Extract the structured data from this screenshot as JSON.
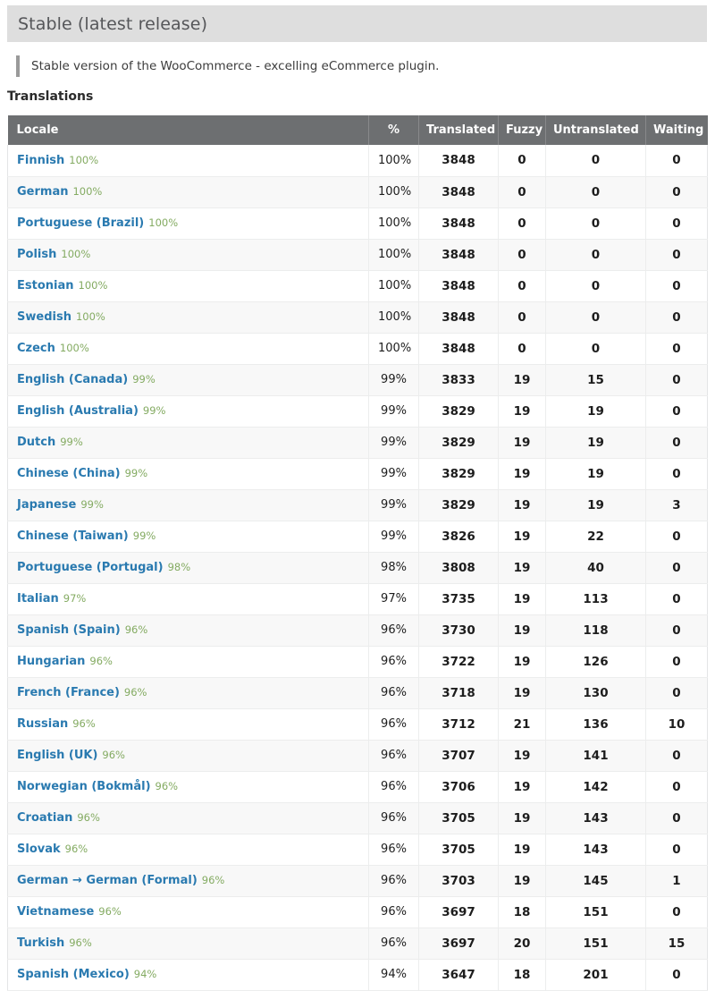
{
  "release": {
    "banner_title": "Stable (latest release)",
    "description": "Stable version of the WooCommerce - excelling eCommerce plugin."
  },
  "translations_section": {
    "heading": "Translations",
    "columns": {
      "locale": "Locale",
      "percent": "%",
      "translated": "Translated",
      "fuzzy": "Fuzzy",
      "untranslated": "Untranslated",
      "waiting": "Waiting"
    },
    "rows": [
      {
        "locale": "Finnish",
        "locale_pct": "100%",
        "percent": "100%",
        "translated": "3848",
        "fuzzy": "0",
        "untranslated": "0",
        "waiting": "0"
      },
      {
        "locale": "German",
        "locale_pct": "100%",
        "percent": "100%",
        "translated": "3848",
        "fuzzy": "0",
        "untranslated": "0",
        "waiting": "0"
      },
      {
        "locale": "Portuguese (Brazil)",
        "locale_pct": "100%",
        "percent": "100%",
        "translated": "3848",
        "fuzzy": "0",
        "untranslated": "0",
        "waiting": "0"
      },
      {
        "locale": "Polish",
        "locale_pct": "100%",
        "percent": "100%",
        "translated": "3848",
        "fuzzy": "0",
        "untranslated": "0",
        "waiting": "0"
      },
      {
        "locale": "Estonian",
        "locale_pct": "100%",
        "percent": "100%",
        "translated": "3848",
        "fuzzy": "0",
        "untranslated": "0",
        "waiting": "0"
      },
      {
        "locale": "Swedish",
        "locale_pct": "100%",
        "percent": "100%",
        "translated": "3848",
        "fuzzy": "0",
        "untranslated": "0",
        "waiting": "0"
      },
      {
        "locale": "Czech",
        "locale_pct": "100%",
        "percent": "100%",
        "translated": "3848",
        "fuzzy": "0",
        "untranslated": "0",
        "waiting": "0"
      },
      {
        "locale": "English (Canada)",
        "locale_pct": "99%",
        "percent": "99%",
        "translated": "3833",
        "fuzzy": "19",
        "untranslated": "15",
        "waiting": "0"
      },
      {
        "locale": "English (Australia)",
        "locale_pct": "99%",
        "percent": "99%",
        "translated": "3829",
        "fuzzy": "19",
        "untranslated": "19",
        "waiting": "0"
      },
      {
        "locale": "Dutch",
        "locale_pct": "99%",
        "percent": "99%",
        "translated": "3829",
        "fuzzy": "19",
        "untranslated": "19",
        "waiting": "0"
      },
      {
        "locale": "Chinese (China)",
        "locale_pct": "99%",
        "percent": "99%",
        "translated": "3829",
        "fuzzy": "19",
        "untranslated": "19",
        "waiting": "0"
      },
      {
        "locale": "Japanese",
        "locale_pct": "99%",
        "percent": "99%",
        "translated": "3829",
        "fuzzy": "19",
        "untranslated": "19",
        "waiting": "3"
      },
      {
        "locale": "Chinese (Taiwan)",
        "locale_pct": "99%",
        "percent": "99%",
        "translated": "3826",
        "fuzzy": "19",
        "untranslated": "22",
        "waiting": "0"
      },
      {
        "locale": "Portuguese (Portugal)",
        "locale_pct": "98%",
        "percent": "98%",
        "translated": "3808",
        "fuzzy": "19",
        "untranslated": "40",
        "waiting": "0"
      },
      {
        "locale": "Italian",
        "locale_pct": "97%",
        "percent": "97%",
        "translated": "3735",
        "fuzzy": "19",
        "untranslated": "113",
        "waiting": "0"
      },
      {
        "locale": "Spanish (Spain)",
        "locale_pct": "96%",
        "percent": "96%",
        "translated": "3730",
        "fuzzy": "19",
        "untranslated": "118",
        "waiting": "0"
      },
      {
        "locale": "Hungarian",
        "locale_pct": "96%",
        "percent": "96%",
        "translated": "3722",
        "fuzzy": "19",
        "untranslated": "126",
        "waiting": "0"
      },
      {
        "locale": "French (France)",
        "locale_pct": "96%",
        "percent": "96%",
        "translated": "3718",
        "fuzzy": "19",
        "untranslated": "130",
        "waiting": "0"
      },
      {
        "locale": "Russian",
        "locale_pct": "96%",
        "percent": "96%",
        "translated": "3712",
        "fuzzy": "21",
        "untranslated": "136",
        "waiting": "10"
      },
      {
        "locale": "English (UK)",
        "locale_pct": "96%",
        "percent": "96%",
        "translated": "3707",
        "fuzzy": "19",
        "untranslated": "141",
        "waiting": "0"
      },
      {
        "locale": "Norwegian (Bokmål)",
        "locale_pct": "96%",
        "percent": "96%",
        "translated": "3706",
        "fuzzy": "19",
        "untranslated": "142",
        "waiting": "0"
      },
      {
        "locale": "Croatian",
        "locale_pct": "96%",
        "percent": "96%",
        "translated": "3705",
        "fuzzy": "19",
        "untranslated": "143",
        "waiting": "0"
      },
      {
        "locale": "Slovak",
        "locale_pct": "96%",
        "percent": "96%",
        "translated": "3705",
        "fuzzy": "19",
        "untranslated": "143",
        "waiting": "0"
      },
      {
        "locale": "German → German (Formal)",
        "locale_pct": "96%",
        "percent": "96%",
        "translated": "3703",
        "fuzzy": "19",
        "untranslated": "145",
        "waiting": "1"
      },
      {
        "locale": "Vietnamese",
        "locale_pct": "96%",
        "percent": "96%",
        "translated": "3697",
        "fuzzy": "18",
        "untranslated": "151",
        "waiting": "0"
      },
      {
        "locale": "Turkish",
        "locale_pct": "96%",
        "percent": "96%",
        "translated": "3697",
        "fuzzy": "20",
        "untranslated": "151",
        "waiting": "15"
      },
      {
        "locale": "Spanish (Mexico)",
        "locale_pct": "94%",
        "percent": "94%",
        "translated": "3647",
        "fuzzy": "18",
        "untranslated": "201",
        "waiting": "0"
      }
    ]
  },
  "colors": {
    "banner_bg": "#dedede",
    "table_header_bg": "#6d6f71",
    "link": "#2a7ab0",
    "badge_green": "#84ab62",
    "row_alt_bg": "#f8f8f8"
  }
}
